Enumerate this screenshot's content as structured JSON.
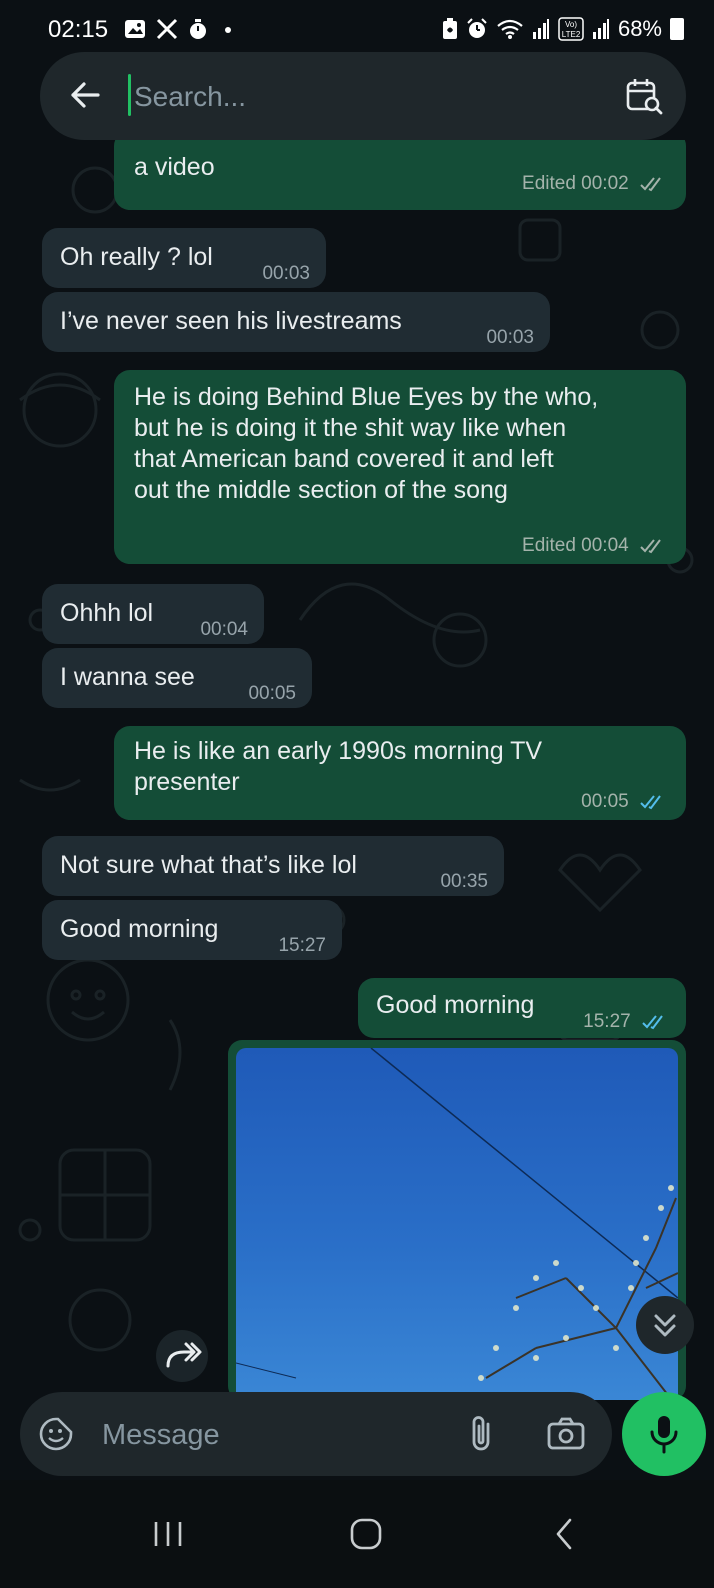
{
  "status_bar": {
    "time": "02:15",
    "battery": "68%",
    "left_icons": [
      "gallery-icon",
      "x-icon",
      "stopwatch-icon",
      "dot-icon"
    ],
    "right_icons": [
      "battery-saver-icon",
      "alarm-icon",
      "wifi-icon",
      "signal-icon",
      "volte-icon",
      "signal-icon",
      "battery-icon"
    ],
    "volte_label": "Vo)\nLTE2"
  },
  "search": {
    "placeholder": "Search...",
    "value": ""
  },
  "messages": [
    {
      "dir": "out",
      "text": "a video",
      "edited": "Edited",
      "time": "00:02",
      "ticks": "read-grey"
    },
    {
      "dir": "in",
      "text": "Oh really ? lol",
      "time": "00:03"
    },
    {
      "dir": "in",
      "text": "I’ve never seen his livestreams",
      "time": "00:03"
    },
    {
      "dir": "out",
      "lines": [
        "He is doing Behind Blue Eyes by the who,",
        "but he is doing it the shit way like when",
        "that American band covered it and left",
        "out the middle section of the song"
      ],
      "edited": "Edited",
      "time": "00:04",
      "ticks": "read-grey"
    },
    {
      "dir": "in",
      "text": "Ohhh lol",
      "time": "00:04"
    },
    {
      "dir": "in",
      "text": "I wanna see",
      "time": "00:05"
    },
    {
      "dir": "out",
      "lines": [
        "He is like an early 1990s morning TV",
        "presenter"
      ],
      "time": "00:05",
      "ticks": "read-blue"
    },
    {
      "dir": "in",
      "text": "Not sure what that’s like lol",
      "time": "00:35"
    },
    {
      "dir": "in",
      "text": "Good morning",
      "time": "15:27"
    },
    {
      "dir": "out",
      "text": "Good morning",
      "time": "15:27",
      "ticks": "read-blue"
    }
  ],
  "photo_message": {
    "alt": "photo of blue sky with tree branches"
  },
  "composer": {
    "placeholder": "Message",
    "value": ""
  },
  "colors": {
    "accent": "#21c063",
    "outgoing_bubble": "#144d37",
    "incoming_bubble": "#202c33",
    "read_tick_blue": "#53bdeb"
  },
  "icons": {
    "back": "arrow-left-icon",
    "calendar_search": "calendar-search-icon",
    "sticker": "sticker-icon",
    "attach": "paperclip-icon",
    "camera": "camera-icon",
    "mic": "mic-icon",
    "forward": "forward-icon",
    "scroll_down": "double-chevron-down-icon",
    "nav_recent": "recent-apps-icon",
    "nav_home": "home-icon",
    "nav_back": "nav-back-icon"
  }
}
